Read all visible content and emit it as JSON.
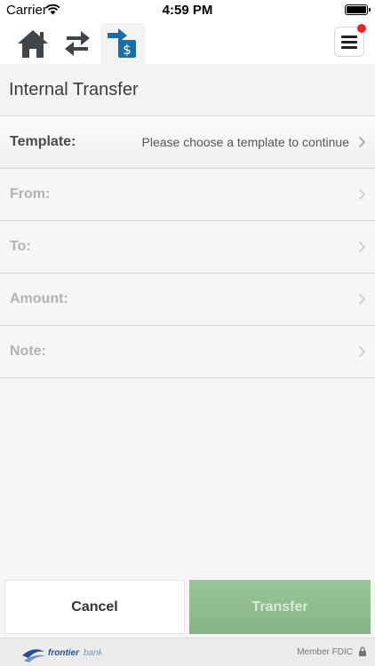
{
  "status_bar": {
    "carrier": "Carrier",
    "time": "4:59 PM"
  },
  "toolbar": {
    "icons": [
      "home-icon",
      "transfer-arrows-icon",
      "bill-pay-icon",
      "hamburger-menu-icon"
    ],
    "notification_color": "#e8242e"
  },
  "page": {
    "title": "Internal Transfer"
  },
  "form": {
    "template": {
      "label": "Template:",
      "value": "Please choose a template to continue"
    },
    "from": {
      "label": "From:"
    },
    "to": {
      "label": "To:"
    },
    "amount": {
      "label": "Amount:"
    },
    "note": {
      "label": "Note:"
    }
  },
  "actions": {
    "cancel": "Cancel",
    "transfer": "Transfer"
  },
  "footer": {
    "logo_text": "frontierbank",
    "member": "Member FDIC"
  },
  "colors": {
    "brand_blue": "#1a6ea8",
    "transfer_green": "#8fbf90",
    "icon_gray": "#3f4549"
  }
}
